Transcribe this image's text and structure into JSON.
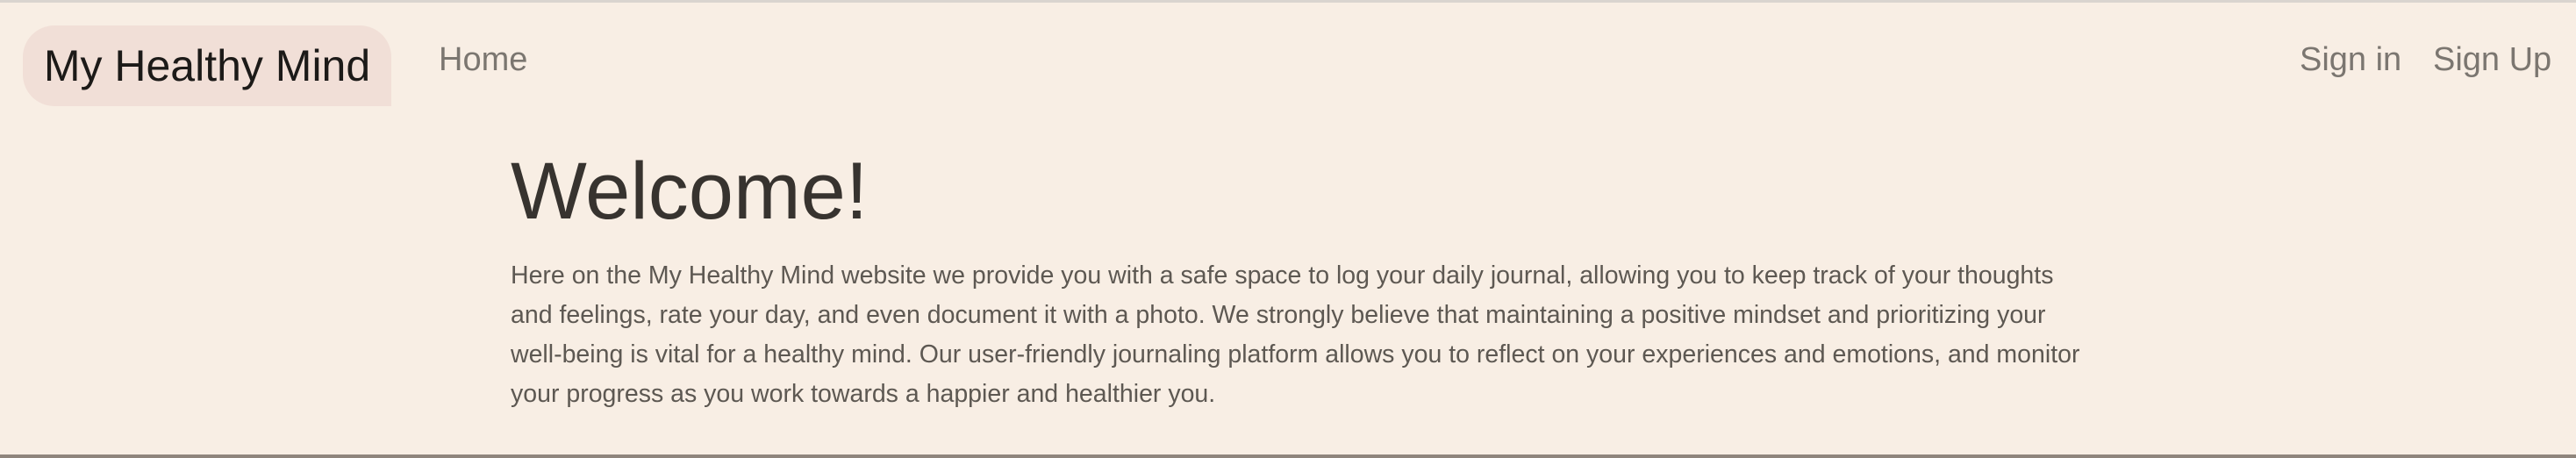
{
  "navbar": {
    "brand": "My Healthy Mind",
    "links": [
      "Home"
    ],
    "auth": [
      "Sign in",
      "Sign Up"
    ]
  },
  "main": {
    "title": "Welcome!",
    "intro": "Here on the My Healthy Mind website we provide you with a safe space to log your daily journal, allowing you to keep track of your thoughts and feelings, rate your day, and even document it with a photo. We strongly believe that maintaining a positive mindset and prioritizing your well-being is vital for a healthy mind. Our user-friendly journaling platform allows you to reflect on your experiences and emotions, and monitor your progress as you work towards a happier and healthier you."
  },
  "colors": {
    "background": "#f8eee4",
    "brand_bg": "#f1dfd7",
    "heading": "#37332f",
    "text": "#5d5852",
    "nav_link": "#7b7670"
  }
}
